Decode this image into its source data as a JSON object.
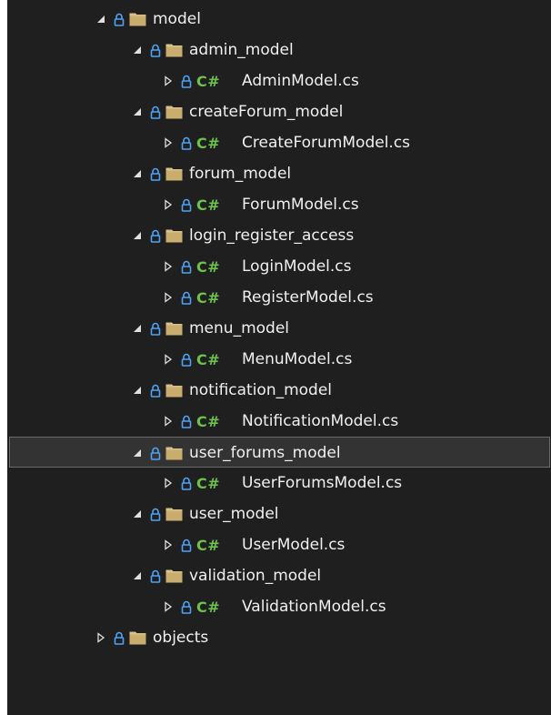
{
  "tree": [
    {
      "level": 0,
      "type": "folder",
      "expanded": true,
      "label": "model"
    },
    {
      "level": 1,
      "type": "folder",
      "expanded": true,
      "label": "admin_model"
    },
    {
      "level": 2,
      "type": "file",
      "expanded": false,
      "label": "AdminModel.cs"
    },
    {
      "level": 1,
      "type": "folder",
      "expanded": true,
      "label": "createForum_model"
    },
    {
      "level": 2,
      "type": "file",
      "expanded": false,
      "label": "CreateForumModel.cs"
    },
    {
      "level": 1,
      "type": "folder",
      "expanded": true,
      "label": "forum_model"
    },
    {
      "level": 2,
      "type": "file",
      "expanded": false,
      "label": "ForumModel.cs"
    },
    {
      "level": 1,
      "type": "folder",
      "expanded": true,
      "label": "login_register_access"
    },
    {
      "level": 2,
      "type": "file",
      "expanded": false,
      "label": "LoginModel.cs"
    },
    {
      "level": 2,
      "type": "file",
      "expanded": false,
      "label": "RegisterModel.cs"
    },
    {
      "level": 1,
      "type": "folder",
      "expanded": true,
      "label": "menu_model"
    },
    {
      "level": 2,
      "type": "file",
      "expanded": false,
      "label": "MenuModel.cs"
    },
    {
      "level": 1,
      "type": "folder",
      "expanded": true,
      "label": "notification_model"
    },
    {
      "level": 2,
      "type": "file",
      "expanded": false,
      "label": "NotificationModel.cs"
    },
    {
      "level": 1,
      "type": "folder",
      "expanded": true,
      "label": "user_forums_model",
      "selected": true
    },
    {
      "level": 2,
      "type": "file",
      "expanded": false,
      "label": "UserForumsModel.cs"
    },
    {
      "level": 1,
      "type": "folder",
      "expanded": true,
      "label": "user_model"
    },
    {
      "level": 2,
      "type": "file",
      "expanded": false,
      "label": "UserModel.cs"
    },
    {
      "level": 1,
      "type": "folder",
      "expanded": true,
      "label": "validation_model"
    },
    {
      "level": 2,
      "type": "file",
      "expanded": false,
      "label": "ValidationModel.cs"
    },
    {
      "level": 0,
      "type": "folder",
      "expanded": false,
      "label": "objects"
    }
  ],
  "file_type_badge": "C#",
  "icons": {
    "expanded": "expanded-triangle-icon",
    "collapsed": "collapsed-triangle-icon",
    "lock": "lock-icon",
    "folder": "folder-icon",
    "csharp": "csharp-file-icon"
  },
  "colors": {
    "background": "#1f1f1f",
    "text": "#f0f0f0",
    "lock": "#4ea3f7",
    "folder": "#d9c28a",
    "csharp": "#6cc24a",
    "selection": "#333333",
    "selection_border": "#6b6b6b",
    "triangle": "#e0e0e0"
  }
}
